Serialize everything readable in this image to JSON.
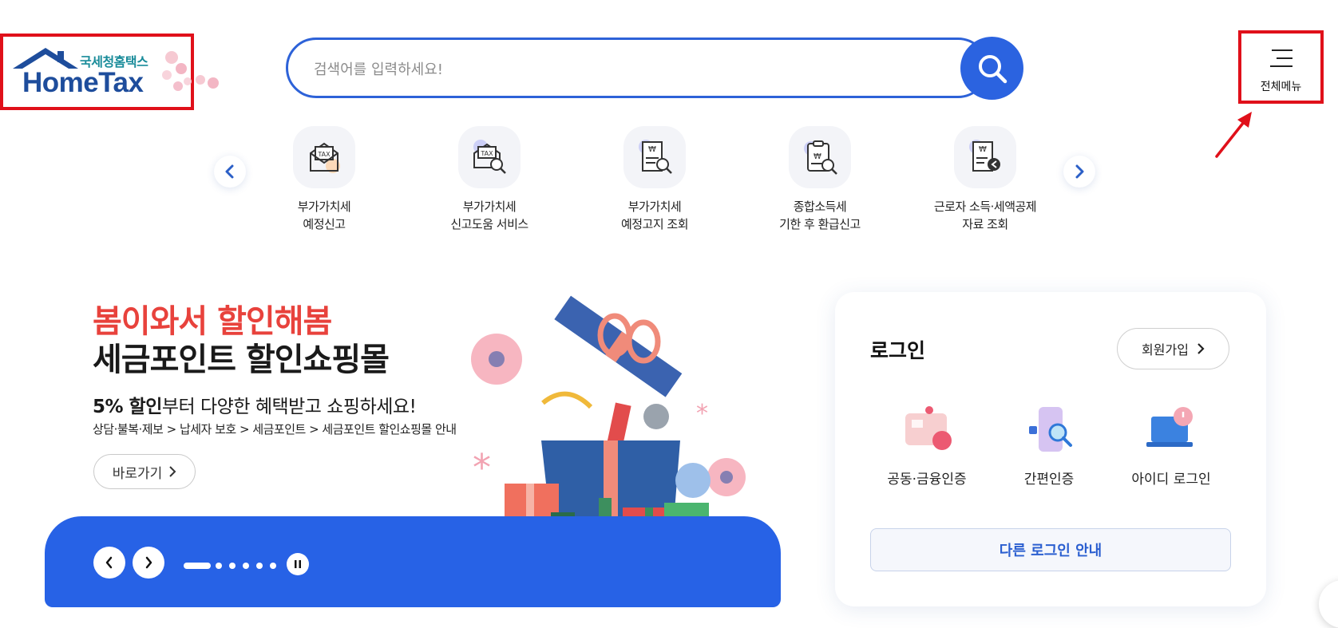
{
  "logo": {
    "subtitle": "국세청홈택스",
    "title": "HomeTax"
  },
  "search": {
    "placeholder": "검색어를 입력하세요!"
  },
  "menu": {
    "label": "전체메뉴"
  },
  "quick_services": [
    {
      "label": "부가가치세\n예정신고",
      "icon": "tax-envelope-icon"
    },
    {
      "label": "부가가치세\n신고도움 서비스",
      "icon": "tax-search-icon"
    },
    {
      "label": "부가가치세\n예정고지 조회",
      "icon": "receipt-search-icon"
    },
    {
      "label": "종합소득세\n기한 후 환급신고",
      "icon": "clipboard-search-icon"
    },
    {
      "label": "근로자 소득·세액공제\n자료 조회",
      "icon": "receipt-back-icon"
    }
  ],
  "banner": {
    "title_line1": "봄이와서 할인해봄",
    "title_line2": "세금포인트 할인쇼핑몰",
    "desc_bold": "5% 할인",
    "desc_rest": "부터 다양한 혜택받고 쇼핑하세요!",
    "path": "상담·불복·제보 > 납세자 보호 > 세금포인트 > 세금포인트 할인쇼핑몰 안내",
    "goto_label": "바로가기",
    "slides_total": 6,
    "slide_active": 1
  },
  "login": {
    "title": "로그인",
    "join_label": "회원가입",
    "options": [
      {
        "label": "공동·금융인증",
        "icon": "certificate-card-icon"
      },
      {
        "label": "간편인증",
        "icon": "phone-search-icon"
      },
      {
        "label": "아이디 로그인",
        "icon": "laptop-power-icon"
      }
    ],
    "other_label": "다른 로그인 안내"
  },
  "colors": {
    "brand": "#2762e6",
    "accent_red": "#e8423c",
    "highlight": "#e0101a"
  }
}
